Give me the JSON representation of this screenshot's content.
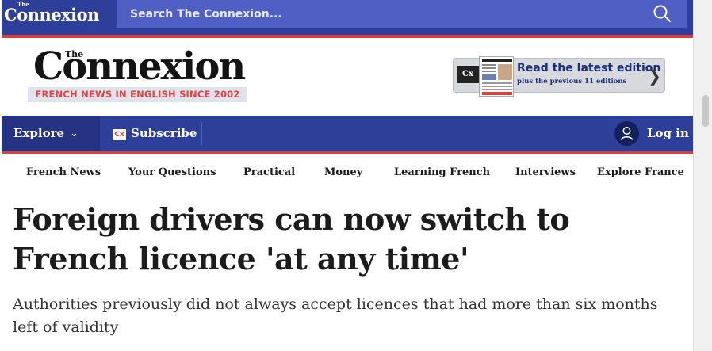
{
  "topbar": {
    "logo_the": "The",
    "logo_text": "Connexion",
    "search_placeholder": "Search The Connexion...",
    "search_icon": "search-icon"
  },
  "header": {
    "logo_the": "The",
    "logo_text": "Connexion",
    "tagline": "FRENCH NEWS IN ENGLISH SINCE 2002",
    "edition": {
      "cx_badge": "Cx",
      "title": "Read the latest edition",
      "subtitle": "plus the previous 11 editions",
      "chevron_icon": "chevron-right-icon"
    }
  },
  "navbar": {
    "explore_label": "Explore",
    "explore_icon": "chevron-down-icon",
    "subscribe_badge": "Cx",
    "subscribe_label": "Subscribe",
    "login_label": "Log in",
    "login_icon": "user-icon"
  },
  "categories": [
    "French News",
    "Your Questions",
    "Practical",
    "Money",
    "Learning French",
    "Interviews",
    "Explore France"
  ],
  "article": {
    "headline": "Foreign drivers can now switch to French licence 'at any time'",
    "standfirst": "Authorities previously did not always accept licences that had more than six months left of validity"
  },
  "colors": {
    "brand_blue": "#2e3f99",
    "search_blue": "#4f5fc4",
    "accent_red": "#d8403a",
    "tagline_bg": "#dfe3ef"
  }
}
